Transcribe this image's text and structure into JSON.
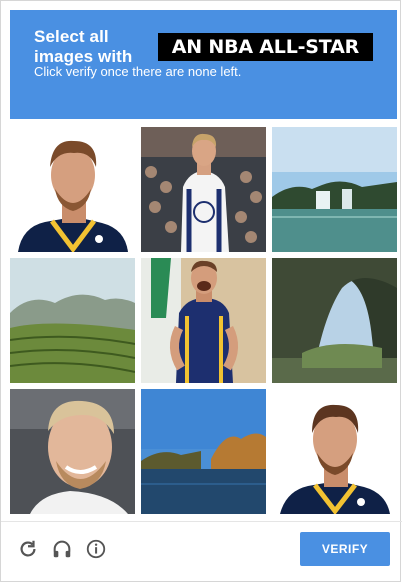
{
  "challenge": {
    "instruction": "Select all images with",
    "keyword": "AN NBA ALL-STAR",
    "subtitle": "Click verify once there are none left."
  },
  "tiles": [
    {
      "icon": "player-portrait-image"
    },
    {
      "icon": "player-white-jersey-image"
    },
    {
      "icon": "waterfall-image"
    },
    {
      "icon": "rice-terraces-image"
    },
    {
      "icon": "player-yellow-jersey-image"
    },
    {
      "icon": "rock-arch-image"
    },
    {
      "icon": "player-smiling-image"
    },
    {
      "icon": "lake-trees-image"
    },
    {
      "icon": "player-portrait-image"
    }
  ],
  "footer": {
    "reload_icon": "reload-icon",
    "audio_icon": "headphones-icon",
    "info_icon": "info-icon",
    "verify_label": "VERIFY"
  },
  "colors": {
    "accent": "#4a90e2",
    "keyword_bg": "#000000"
  }
}
